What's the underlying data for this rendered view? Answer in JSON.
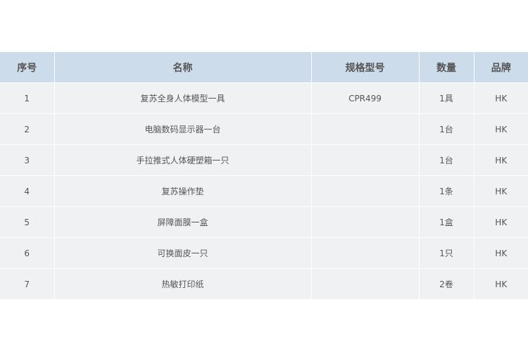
{
  "table": {
    "headers": [
      "序号",
      "名称",
      "规格型号",
      "数量",
      "品牌"
    ],
    "rows": [
      [
        "1",
        "复苏全身人体模型一具",
        "CPR499",
        "1具",
        "HK"
      ],
      [
        "2",
        "电脑数码显示器一台",
        "",
        "1台",
        "HK"
      ],
      [
        "3",
        "手拉推式人体硬塑箱一只",
        "",
        "1台",
        "HK"
      ],
      [
        "4",
        "复苏操作垫",
        "",
        "1条",
        "HK"
      ],
      [
        "5",
        "屏障面膜一盒",
        "",
        "1盒",
        "HK"
      ],
      [
        "6",
        "可换面皮一只",
        "",
        "1只",
        "HK"
      ],
      [
        "7",
        "热敏打印纸",
        "",
        "2卷",
        "HK"
      ]
    ]
  }
}
